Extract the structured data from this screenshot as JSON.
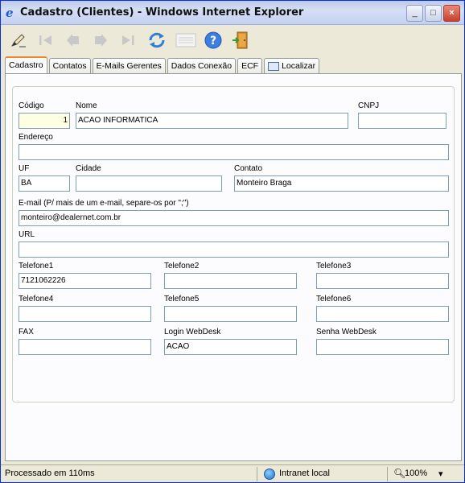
{
  "window": {
    "title": "Cadastro (Clientes) - Windows Internet Explorer",
    "minimize_glyph": "_",
    "maximize_glyph": "□",
    "close_glyph": "×"
  },
  "toolbar": {
    "icons": [
      "pen-edit-icon",
      "first-record-icon",
      "previous-record-icon",
      "next-record-icon",
      "last-record-icon",
      "refresh-icon",
      "list-view-icon",
      "help-icon",
      "exit-door-icon"
    ]
  },
  "tabs": [
    {
      "label": "Cadastro",
      "active": true
    },
    {
      "label": "Contatos"
    },
    {
      "label": "E-Mails Gerentes"
    },
    {
      "label": "Dados Conexão"
    },
    {
      "label": "ECF"
    },
    {
      "label": "Localizar",
      "icon": "search-window-icon"
    }
  ],
  "form": {
    "codigo": {
      "label": "Código",
      "value": "1"
    },
    "nome": {
      "label": "Nome",
      "value": "ACAO INFORMATICA"
    },
    "cnpj": {
      "label": "CNPJ",
      "value": ""
    },
    "endereco": {
      "label": "Endereço",
      "value": ""
    },
    "uf": {
      "label": "UF",
      "value": "BA"
    },
    "cidade": {
      "label": "Cidade",
      "value": ""
    },
    "contato": {
      "label": "Contato",
      "value": "Monteiro Braga"
    },
    "email": {
      "label": "E-mail (P/ mais de um e-mail, separe-os por \";\")",
      "value": "monteiro@dealernet.com.br"
    },
    "url": {
      "label": "URL",
      "value": ""
    },
    "telefone1": {
      "label": "Telefone1",
      "value": "7121062226"
    },
    "telefone2": {
      "label": "Telefone2",
      "value": ""
    },
    "telefone3": {
      "label": "Telefone3",
      "value": ""
    },
    "telefone4": {
      "label": "Telefone4",
      "value": ""
    },
    "telefone5": {
      "label": "Telefone5",
      "value": ""
    },
    "telefone6": {
      "label": "Telefone6",
      "value": ""
    },
    "fax": {
      "label": "FAX",
      "value": ""
    },
    "login_webdesk": {
      "label": "Login WebDesk",
      "value": "ACAO"
    },
    "senha_webdesk": {
      "label": "Senha WebDesk",
      "value": ""
    }
  },
  "statusbar": {
    "status": "Processado em 110ms",
    "zone": "Intranet local",
    "zoom": "100%",
    "zoom_arrow": "▾"
  }
}
